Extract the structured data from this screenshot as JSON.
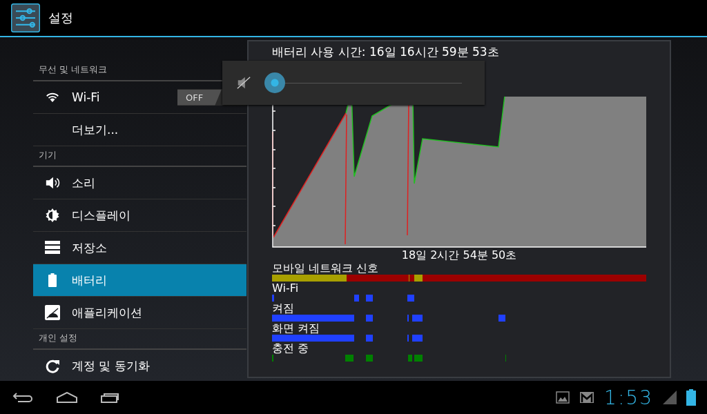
{
  "action_bar": {
    "title": "설정"
  },
  "sections": [
    {
      "header": "무선 및 네트워크",
      "items": [
        {
          "label": "Wi-Fi",
          "selected": false,
          "toggle": {
            "label": "OFF",
            "on": false
          }
        },
        {
          "label": "더보기...",
          "selected": false
        }
      ]
    },
    {
      "header": "기기",
      "items": [
        {
          "label": "소리",
          "selected": false
        },
        {
          "label": "디스플레이",
          "selected": false
        },
        {
          "label": "저장소",
          "selected": false
        },
        {
          "label": "배터리",
          "selected": true
        },
        {
          "label": "애플리케이션",
          "selected": false
        }
      ]
    },
    {
      "header": "개인 설정",
      "items": [
        {
          "label": "계정 및 동기화",
          "selected": false
        }
      ]
    }
  ],
  "battery": {
    "title": "배터리 사용 시간: 16일 16시간 59분 53초",
    "graph_caption": "18일 2시간 54분 50초",
    "timelines": [
      "모바일 네트워크 신호",
      "Wi-Fi",
      "켜짐",
      "화면 켜짐",
      "충전 중"
    ]
  },
  "volume_popup": {
    "muted": true,
    "level": 0
  },
  "status": {
    "time": "1:53"
  }
}
